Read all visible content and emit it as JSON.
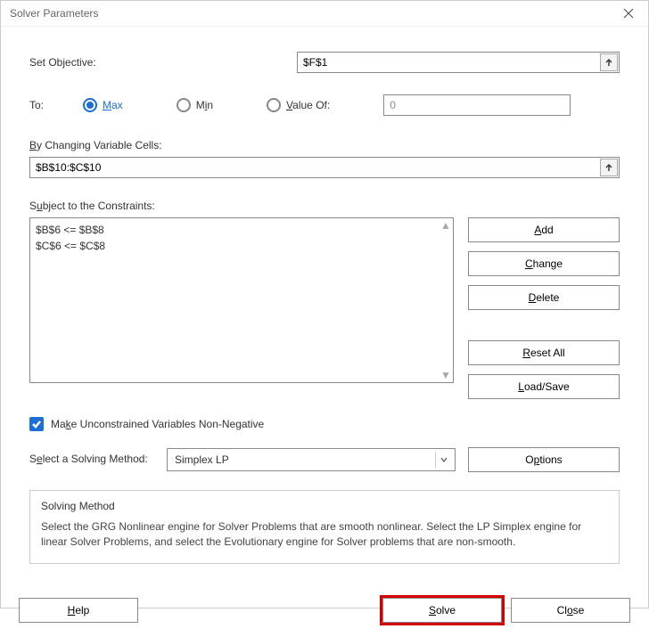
{
  "window": {
    "title": "Solver Parameters"
  },
  "objective": {
    "label_pre": "Set Ob",
    "label_key": "j",
    "label_post": "ective:",
    "value": "$F$1"
  },
  "to": {
    "label": "To:",
    "max_key": "M",
    "max_post": "ax",
    "min_key": "M",
    "min_mid": "i",
    "min_post": "n",
    "valueof_key": "V",
    "valueof_post": "alue Of:",
    "valueof_value": "0",
    "selected": "max"
  },
  "changing": {
    "label_key": "B",
    "label_post": "y Changing Variable Cells:",
    "value": "$B$10:$C$10"
  },
  "constraints": {
    "label_pre": "S",
    "label_key": "u",
    "label_post": "bject to the Constraints:",
    "items": [
      "$B$6 <= $B$8",
      "$C$6 <= $C$8"
    ]
  },
  "sidebuttons": {
    "add_key": "A",
    "add_post": "dd",
    "change_key": "C",
    "change_post": "hange",
    "delete_key": "D",
    "delete_post": "elete",
    "reset_key": "R",
    "reset_post": "eset All",
    "load_pre": "",
    "load_key": "L",
    "load_post": "oad/Save"
  },
  "nonneg": {
    "checked": true,
    "label_pre": "Ma",
    "label_key": "k",
    "label_post": "e Unconstrained Variables Non-Negative"
  },
  "method": {
    "label_pre": "S",
    "label_key": "e",
    "label_post": "lect a Solving Method:",
    "selected": "Simplex LP",
    "options_pre": "O",
    "options_key": "p",
    "options_post": "tions"
  },
  "desc": {
    "title": "Solving Method",
    "text": "Select the GRG Nonlinear engine for Solver Problems that are smooth nonlinear. Select the LP Simplex engine for linear Solver Problems, and select the Evolutionary engine for Solver problems that are non-smooth."
  },
  "footer": {
    "help_key": "H",
    "help_post": "elp",
    "solve_key": "S",
    "solve_post": "olve",
    "close_pre": "Cl",
    "close_key": "o",
    "close_post": "se"
  }
}
